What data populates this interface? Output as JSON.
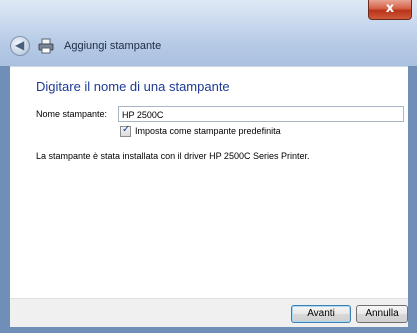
{
  "window": {
    "title": "Aggiungi stampante",
    "close_glyph": "x"
  },
  "icons": {
    "back": "back-arrow-icon",
    "printer": "printer-icon"
  },
  "page": {
    "heading": "Digitare il nome di una stampante",
    "name_label": "Nome stampante:",
    "name_value": "HP 2500C",
    "default_checkbox_label": "Imposta come stampante predefinita",
    "default_checked": true,
    "info_text": "La stampante è stata installata con il driver HP 2500C Series Printer."
  },
  "footer": {
    "next_label": "Avanti",
    "cancel_label": "Annulla"
  }
}
